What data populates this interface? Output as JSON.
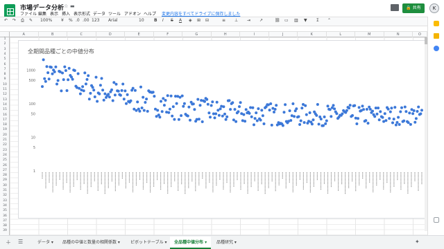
{
  "header": {
    "title": "市場データ分析",
    "star_icon": "star-icon",
    "folder_icon": "folder-icon",
    "menus": [
      "ファイル",
      "編集",
      "表示",
      "挿入",
      "表示形式",
      "データ",
      "ツール",
      "アドオン",
      "ヘルプ"
    ],
    "save_status": "変更内容をすべてドライブに保存しました",
    "share_label": "共有",
    "avatar_initial": "K"
  },
  "toolbar": {
    "zoom": "100%",
    "currency": "¥",
    "percent": "%",
    "decimals_dec": ".0",
    "decimals_inc": ".00",
    "format_more": "123",
    "font": "Arial",
    "font_size": "10",
    "bold": "B",
    "italic": "I",
    "strike": "S",
    "text_color": "A"
  },
  "columns": [
    "A",
    "B",
    "C",
    "D",
    "E",
    "F",
    "G",
    "H",
    "I",
    "J",
    "K",
    "L",
    "M",
    "N",
    "O"
  ],
  "rows": [
    "1",
    "2",
    "3",
    "4",
    "5",
    "6",
    "7",
    "8",
    "9",
    "10",
    "11",
    "12",
    "13",
    "14",
    "15",
    "16",
    "17",
    "18",
    "19",
    "20",
    "21",
    "22",
    "23",
    "24",
    "25",
    "26",
    "27",
    "28",
    "29",
    "30",
    "31",
    "32",
    "33",
    "34",
    "35",
    "36",
    "37",
    "38",
    "39"
  ],
  "chart_data": {
    "type": "scatter",
    "title": "全期間品種ごとの中値分布",
    "xlabel": "",
    "ylabel": "",
    "y_scale": "log",
    "yticks": [
      1,
      5,
      10,
      50,
      100,
      500,
      1000
    ],
    "ylim": [
      1,
      2000
    ],
    "point_count": 340,
    "curve": {
      "start": 900,
      "end": 45
    },
    "color": "#3c78d8",
    "legend": "none",
    "grid": false
  },
  "tabs": {
    "add_icon": "plus-icon",
    "list_icon": "list-icon",
    "items": [
      {
        "label": "データ",
        "active": false
      },
      {
        "label": "品種の中値と数量の相関係数",
        "active": false
      },
      {
        "label": "ピボットテーブル",
        "active": false
      },
      {
        "label": "全品種中値分布",
        "active": true
      },
      {
        "label": "品種研究",
        "active": false
      }
    ],
    "explore_icon": "explore-icon"
  },
  "side": {
    "calendar_color": "#fbbc04",
    "keep_color": "#f4b400",
    "tasks_color": "#4285f4"
  }
}
